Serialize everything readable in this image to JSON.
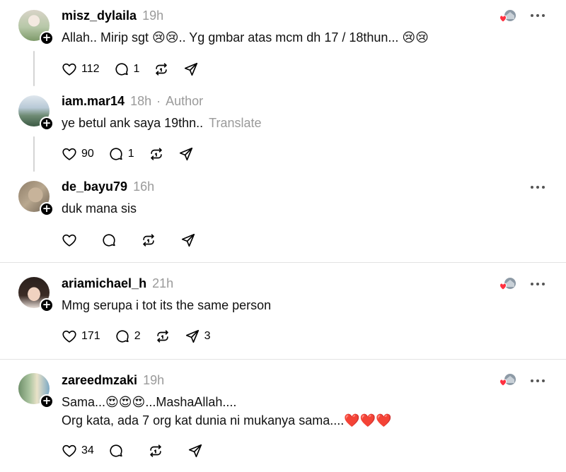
{
  "replies": [
    {
      "username": "misz_dylaila",
      "time": "19h",
      "text": "Allah.. Mirip sgt 😢😢.. Yg gmbar atas mcm dh 17 / 18thun... 😢😢",
      "likes": "112",
      "comments": "1",
      "reposts": "",
      "shares": "",
      "liked_by_author": true
    },
    {
      "username": "iam.mar14",
      "time": "18h",
      "separator": "·",
      "author_tag": "Author",
      "text": "ye betul ank saya 19thn..",
      "translate": "Translate",
      "likes": "90",
      "comments": "1",
      "reposts": "",
      "shares": ""
    },
    {
      "username": "de_bayu79",
      "time": "16h",
      "text": "duk mana sis",
      "likes": "",
      "comments": "",
      "reposts": "",
      "shares": ""
    },
    {
      "username": "ariamichael_h",
      "time": "21h",
      "text": "Mmg serupa i tot its the same person",
      "likes": "171",
      "comments": "2",
      "reposts": "",
      "shares": "3",
      "liked_by_author": true
    },
    {
      "username": "zareedmzaki",
      "time": "19h",
      "text_line1": "Sama...😍😍😍...MashaAllah....",
      "text_line2": "Org kata, ada 7 org kat dunia ni mukanya sama....❤️❤️❤️",
      "likes": "34",
      "comments": "",
      "reposts": "",
      "shares": "",
      "liked_by_author": true
    }
  ],
  "icons": {
    "like": "heart-icon",
    "comment": "comment-bubble-icon",
    "repost": "repost-icon",
    "share": "send-icon",
    "more": "more-dots-icon",
    "follow": "plus-icon"
  },
  "colors": {
    "heart_red": "#ff3040",
    "muted_text": "#9a9a9a",
    "divider": "#e3e3e3"
  }
}
